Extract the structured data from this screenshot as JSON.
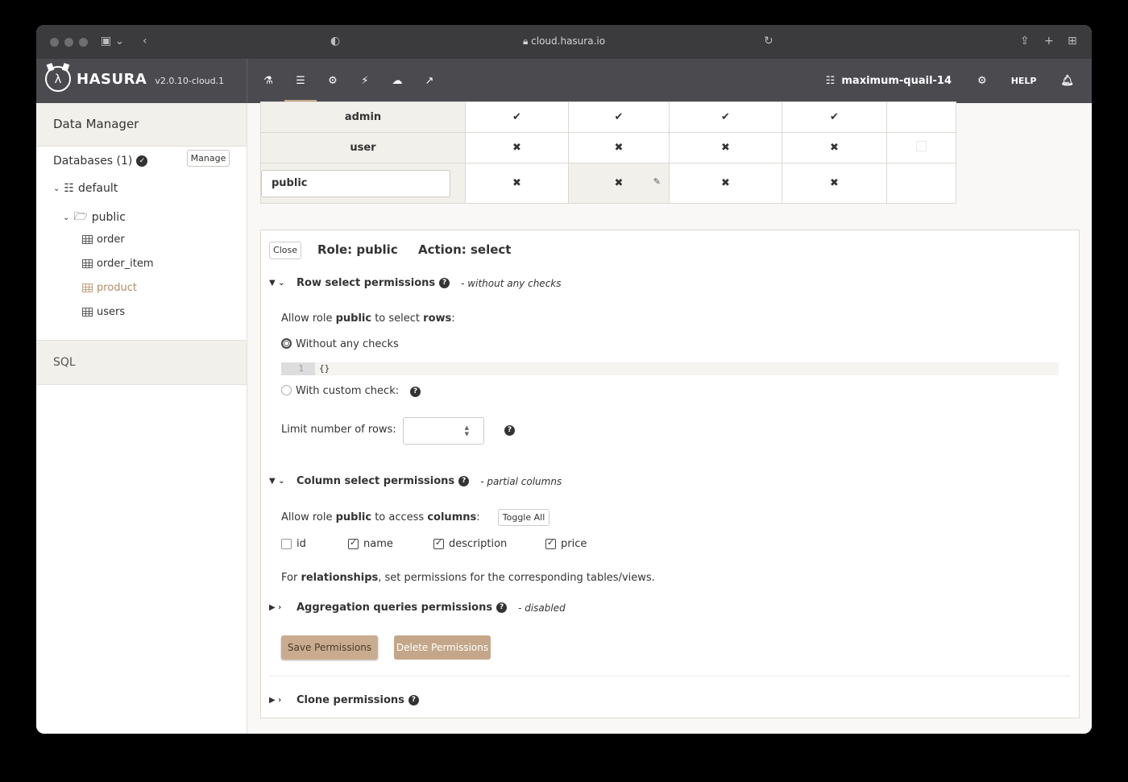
{
  "browser": {
    "url": "cloud.hasura.io"
  },
  "header": {
    "logo_text": "HASURA",
    "version": "v2.0.10-cloud.1",
    "project_name": "maximum-quail-14",
    "help_label": "HELP",
    "nav_icons": [
      "api-explorer-icon",
      "data-icon",
      "actions-icon",
      "remote-schemas-icon",
      "events-icon",
      "monitoring-icon"
    ]
  },
  "sidebar": {
    "title": "Data Manager",
    "databases_label": "Databases (1)",
    "manage_label": "Manage",
    "database": "default",
    "schema": "public",
    "tables": [
      "order",
      "order_item",
      "product",
      "users"
    ],
    "selected_table": "product",
    "sql_label": "SQL"
  },
  "permissions_table": {
    "rows": [
      {
        "role": "admin",
        "cells": [
          "check",
          "check",
          "check",
          "check",
          ""
        ]
      },
      {
        "role": "user",
        "cells": [
          "cross",
          "cross",
          "cross",
          "cross",
          "empty"
        ]
      },
      {
        "role": "public",
        "cells": [
          "cross",
          "cross",
          "cross",
          "cross",
          ""
        ]
      }
    ]
  },
  "editor": {
    "close_label": "Close",
    "role_title": "Role: public",
    "action_title": "Action: select",
    "row_section": {
      "title": "Row select permissions",
      "note": "- without any checks",
      "allow_prefix": "Allow role ",
      "allow_role": "public",
      "allow_mid": " to select ",
      "allow_obj": "rows",
      "allow_suffix": ":",
      "option_without": "Without any checks",
      "code_line_no": "1",
      "code_value": "{}",
      "option_custom": "With custom check:",
      "limit_label": "Limit number of rows:",
      "limit_value": ""
    },
    "column_section": {
      "title": "Column select permissions",
      "note": "- partial columns",
      "allow_prefix": "Allow role ",
      "allow_role": "public",
      "allow_mid": " to access ",
      "allow_obj": "columns",
      "allow_suffix": ":",
      "toggle_all_label": "Toggle All",
      "columns": [
        {
          "name": "id",
          "checked": false
        },
        {
          "name": "name",
          "checked": true
        },
        {
          "name": "description",
          "checked": true
        },
        {
          "name": "price",
          "checked": true
        }
      ],
      "relationships_prefix": "For ",
      "relationships_bold": "relationships",
      "relationships_suffix": ", set permissions for the corresponding tables/views."
    },
    "aggregation_section": {
      "title": "Aggregation queries permissions",
      "note": "- disabled"
    },
    "save_label": "Save Permissions",
    "delete_label": "Delete Permissions",
    "clone_section": {
      "title": "Clone permissions"
    }
  },
  "colors": {
    "accent": "#c4a78a",
    "nav_bg": "#4a4a4f",
    "sidebar_bg": "#f2f0eb"
  }
}
